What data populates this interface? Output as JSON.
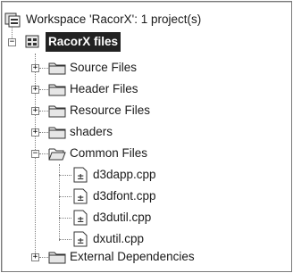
{
  "tree": {
    "workspace": {
      "label": "Workspace 'RacorX': 1 project(s)",
      "icon": "workspace-icon"
    },
    "project": {
      "label": "RacorX files",
      "icon": "project-icon",
      "expanded": true
    },
    "folders": [
      {
        "label": "Source Files",
        "expanded": false
      },
      {
        "label": "Header Files",
        "expanded": false
      },
      {
        "label": "Resource Files",
        "expanded": false
      },
      {
        "label": "shaders",
        "expanded": false
      },
      {
        "label": "Common Files",
        "expanded": true,
        "files": [
          "d3dapp.cpp",
          "d3dfont.cpp",
          "d3dutil.cpp",
          "dxutil.cpp"
        ]
      },
      {
        "label": "External Dependencies",
        "expanded": false
      }
    ],
    "expander_collapsed": "+",
    "expander_expanded": "−"
  }
}
